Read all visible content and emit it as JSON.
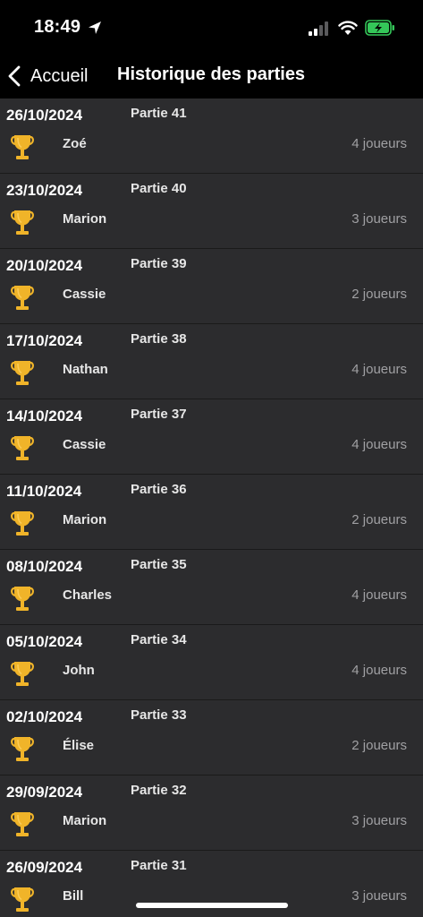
{
  "status_bar": {
    "time": "18:49",
    "battery_color": "#34c759"
  },
  "nav": {
    "back_label": "Accueil",
    "title": "Historique des parties"
  },
  "colors": {
    "trophy": "#f0b429",
    "row_background": "#2c2c2e"
  },
  "games": [
    {
      "date": "26/10/2024",
      "name": "Partie 41",
      "winner": "Zoé",
      "players": "4 joueurs"
    },
    {
      "date": "23/10/2024",
      "name": "Partie 40",
      "winner": "Marion",
      "players": "3 joueurs"
    },
    {
      "date": "20/10/2024",
      "name": "Partie 39",
      "winner": "Cassie",
      "players": "2 joueurs"
    },
    {
      "date": "17/10/2024",
      "name": "Partie 38",
      "winner": "Nathan",
      "players": "4 joueurs"
    },
    {
      "date": "14/10/2024",
      "name": "Partie 37",
      "winner": "Cassie",
      "players": "4 joueurs"
    },
    {
      "date": "11/10/2024",
      "name": "Partie 36",
      "winner": "Marion",
      "players": "2 joueurs"
    },
    {
      "date": "08/10/2024",
      "name": "Partie 35",
      "winner": "Charles",
      "players": "4 joueurs"
    },
    {
      "date": "05/10/2024",
      "name": "Partie 34",
      "winner": "John",
      "players": "4 joueurs"
    },
    {
      "date": "02/10/2024",
      "name": "Partie 33",
      "winner": "Élise",
      "players": "2 joueurs"
    },
    {
      "date": "29/09/2024",
      "name": "Partie 32",
      "winner": "Marion",
      "players": "3 joueurs"
    },
    {
      "date": "26/09/2024",
      "name": "Partie 31",
      "winner": "Bill",
      "players": "3 joueurs"
    }
  ]
}
